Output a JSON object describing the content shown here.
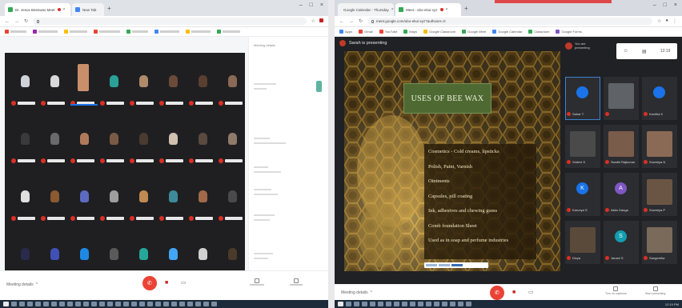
{
  "left_window": {
    "tabs": [
      {
        "label": "Dr. Jesus Beeswax Meet"
      },
      {
        "label": "New Tab"
      }
    ],
    "url": "",
    "meeting_details": "Meeting details",
    "side_heading": "Meeting details",
    "side_lines": [
      "",
      "",
      "",
      ""
    ]
  },
  "right_window": {
    "tabs": [
      {
        "label": "Google Calendar - Thursday"
      },
      {
        "label": "Meet - ubo-ekui-xyz"
      }
    ],
    "url": "meet.google.com/ubo-ekui-xyz?authuser=0",
    "bookmarks": [
      "Apps",
      "Gmail",
      "YouTube",
      "Maps",
      "Google Classroom",
      "Google Meet",
      "Google Calendar",
      "Classroom",
      "Google Forms"
    ],
    "presenting_label": "Sarah is presenting",
    "you_label_1": "You are",
    "you_label_2": "presenting",
    "time": "12:19",
    "slide": {
      "title": "USES OF BEE WAX",
      "items": [
        "Cosmetics - Cold creams, lipsticks",
        "Polish, Paint, Varnish",
        "Ointments",
        "Capsules, pill coating",
        "Ink, adhesives and chewing gums",
        "Comb foundation Sheet",
        "Used as in soap and perfume industries"
      ]
    },
    "tiles": [
      {
        "initial": "",
        "caption": "Sahar T.",
        "color": "#1a73e8",
        "kind": "avatar"
      },
      {
        "initial": "",
        "caption": "",
        "color": "#5f6368",
        "kind": "photo"
      },
      {
        "initial": "",
        "caption": "Kavitha K",
        "color": "#1a73e8",
        "kind": "avatar"
      },
      {
        "initial": "",
        "caption": "Sridevi S",
        "color": "#4a4a4a",
        "kind": "photo"
      },
      {
        "initial": "",
        "caption": "Swathi Rajkumar",
        "color": "#7a5c4a",
        "kind": "photo"
      },
      {
        "initial": "",
        "caption": "Sowmiya N",
        "color": "#8a6a55",
        "kind": "photo"
      },
      {
        "initial": "K",
        "caption": "Karunya S",
        "color": "#1a73e8",
        "kind": "avatar"
      },
      {
        "initial": "A",
        "caption": "Akila Ganga",
        "color": "#7e57c2",
        "kind": "avatar"
      },
      {
        "initial": "",
        "caption": "Sowmiya P",
        "color": "#6a5545",
        "kind": "photo"
      },
      {
        "initial": "",
        "caption": "Divya",
        "color": "#5a4a3a",
        "kind": "photo"
      },
      {
        "initial": "S",
        "caption": "Janani S",
        "color": "#129eaf",
        "kind": "avatar"
      },
      {
        "initial": "",
        "caption": "Sangeetha",
        "color": "#7a6a5a",
        "kind": "photo"
      }
    ],
    "meeting_details": "Meeting details",
    "tools": [
      "Turn on captions",
      "Start presenting"
    ],
    "taskbar_time": "12:19 PM"
  },
  "colors": {
    "end_call": "#ea4335",
    "accent": "#1a73e8",
    "slide_title_bg": "#4e6a32"
  }
}
